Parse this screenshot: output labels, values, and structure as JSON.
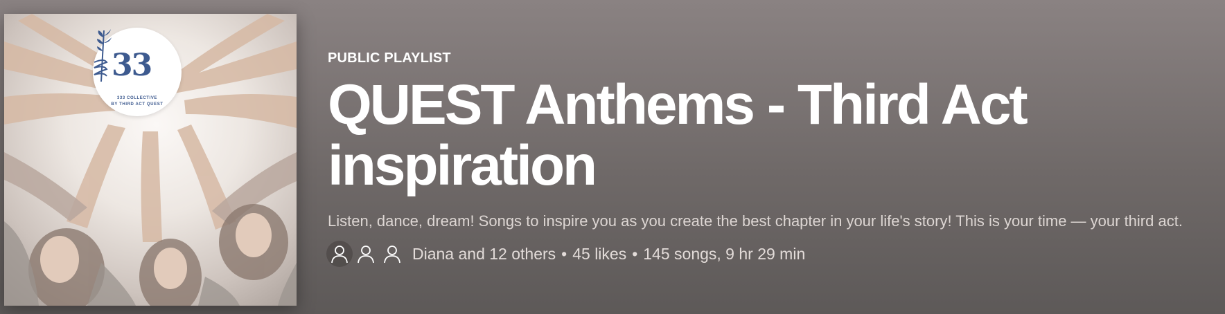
{
  "playlist": {
    "type_label": "PUBLIC PLAYLIST",
    "title": "QUEST Anthems - Third Act inspiration",
    "description": "Listen, dance, dream! Songs to inspire you as you create the best chapter in your life's story! This is your time — your third act.",
    "collaborators": "Diana and 12 others",
    "likes": "45 likes",
    "stats": "145 songs, 9 hr 29 min",
    "separator": "•"
  },
  "cover": {
    "logo_number": "33",
    "logo_line1": "333 COLLECTIVE",
    "logo_line2": "BY THIRD ACT QUEST",
    "logo_icon": "sprig-icon"
  },
  "avatars": [
    {
      "icon": "user-icon"
    },
    {
      "icon": "user-icon"
    },
    {
      "icon": "user-icon"
    }
  ],
  "colors": {
    "background": "#6f6968",
    "text_primary": "#ffffff",
    "text_secondary": "#ddd6d3",
    "logo_blue": "#3d5a8f"
  }
}
